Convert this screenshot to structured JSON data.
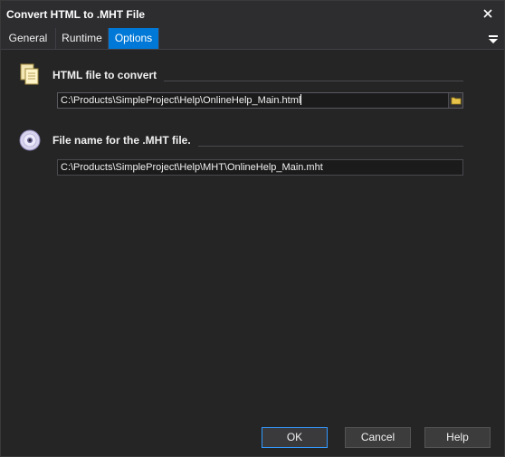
{
  "window": {
    "title": "Convert HTML to .MHT File"
  },
  "tabs": [
    {
      "label": "General",
      "active": false
    },
    {
      "label": "Runtime",
      "active": false
    },
    {
      "label": "Options",
      "active": true
    }
  ],
  "sections": {
    "html_file": {
      "label": "HTML file to convert",
      "value": "C:\\Products\\SimpleProject\\Help\\OnlineHelp_Main.html",
      "icon": "documents-icon"
    },
    "mht_file": {
      "label": "File name for the .MHT file.",
      "value": "C:\\Products\\SimpleProject\\Help\\MHT\\OnlineHelp_Main.mht",
      "icon": "disc-icon"
    }
  },
  "buttons": {
    "ok": "OK",
    "cancel": "Cancel",
    "help": "Help"
  },
  "colors": {
    "accent": "#0078d7",
    "background": "#252526",
    "text": "#f1f1f1"
  }
}
